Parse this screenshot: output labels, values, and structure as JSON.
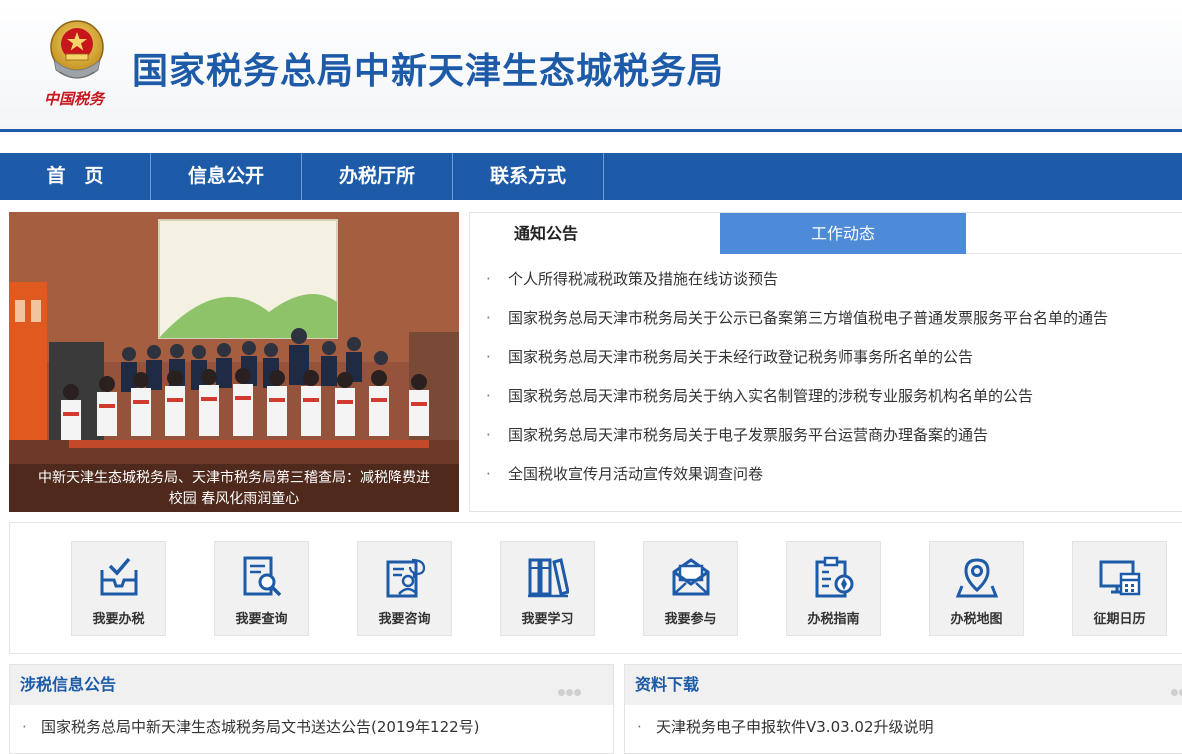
{
  "header": {
    "title": "国家税务总局中新天津生态城税务局",
    "emblem_text": "中国税务"
  },
  "nav": {
    "items": [
      "首　页",
      "信息公开",
      "办税厅所",
      "联系方式"
    ]
  },
  "banner": {
    "caption_line1": "中新天津生态城税务局、天津市税务局第三稽查局：减税降费进",
    "caption_line2": "校园 春风化雨润童心"
  },
  "notice": {
    "tabs": [
      "通知公告",
      "工作动态"
    ],
    "bullet": "·",
    "items": [
      "个人所得税减税政策及措施在线访谈预告",
      "国家税务总局天津市税务局关于公示已备案第三方增值税电子普通发票服务平台名单的通告",
      "国家税务总局天津市税务局关于未经行政登记税务师事务所名单的公告",
      "国家税务总局天津市税务局关于纳入实名制管理的涉税专业服务机构名单的公告",
      "国家税务总局天津市税务局关于电子发票服务平台运营商办理备案的通告",
      "全国税收宣传月活动宣传效果调查问卷"
    ]
  },
  "services": [
    {
      "label": "我要办税",
      "icon": "tax-filing-icon"
    },
    {
      "label": "我要查询",
      "icon": "document-search-icon"
    },
    {
      "label": "我要咨询",
      "icon": "consult-icon"
    },
    {
      "label": "我要学习",
      "icon": "books-icon"
    },
    {
      "label": "我要参与",
      "icon": "envelope-icon"
    },
    {
      "label": "办税指南",
      "icon": "clipboard-guide-icon"
    },
    {
      "label": "办税地图",
      "icon": "map-pin-icon"
    },
    {
      "label": "征期日历",
      "icon": "calendar-monitor-icon"
    }
  ],
  "panels": {
    "left": {
      "title": "涉税信息公告",
      "items": [
        "国家税务总局中新天津生态城税务局文书送达公告(2019年122号)"
      ]
    },
    "right": {
      "title": "资料下载",
      "items": [
        "天津税务电子申报软件V3.03.02升级说明"
      ]
    }
  },
  "colors": {
    "brand_blue": "#1d5aa7",
    "tab_blue": "#4d8ad8",
    "emblem_red": "#c8161d",
    "emblem_gold": "#e0b23c"
  }
}
